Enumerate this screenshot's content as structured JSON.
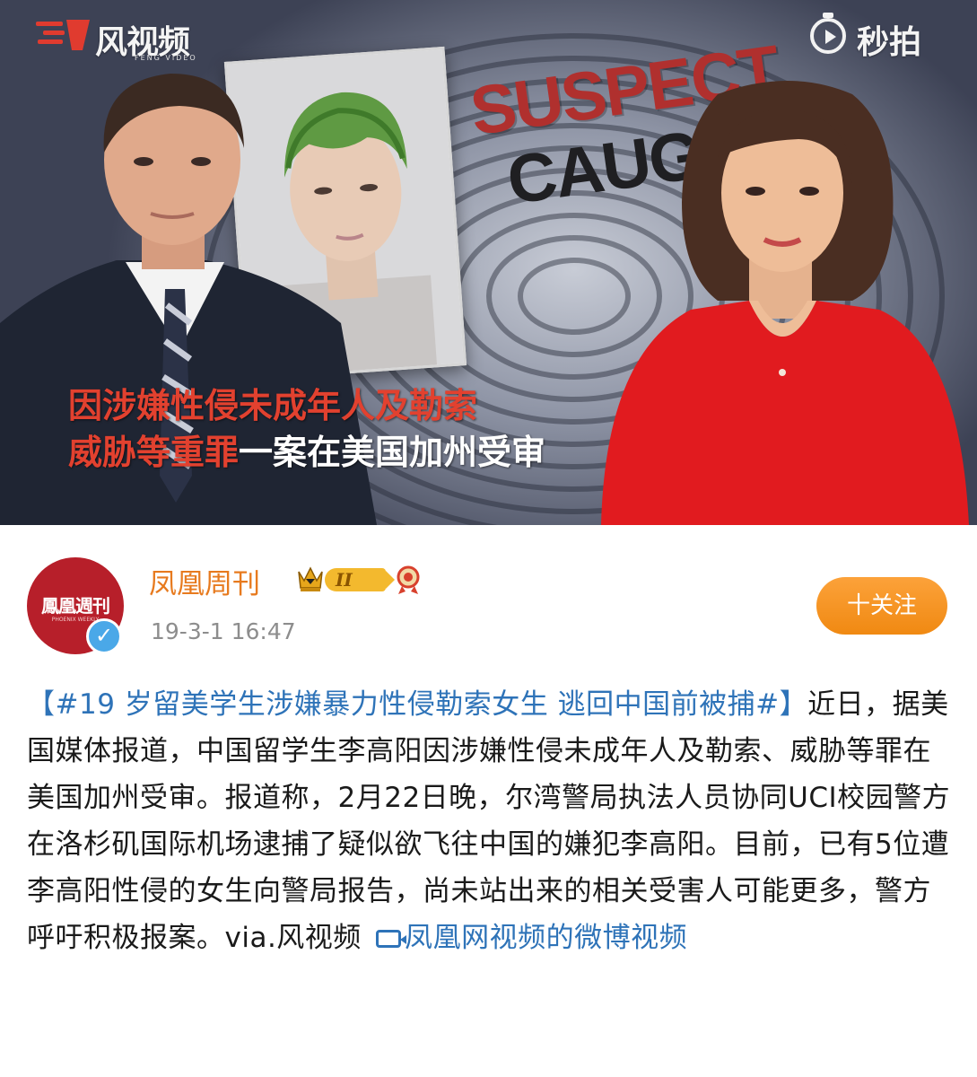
{
  "video": {
    "watermark_left": {
      "text": "风视频",
      "subtext": "FENG VIDEO"
    },
    "watermark_right": {
      "text": "秒拍"
    },
    "headline": {
      "line1": "SUSPECT",
      "line2": "CAUGHT"
    },
    "caption": {
      "line1_red": "因涉嫌性侵未成年人及勒索",
      "line2_red": "威胁等重罪",
      "line2_white": "一案在美国加州受审"
    }
  },
  "post": {
    "avatar_text": "鳳凰週刊",
    "avatar_subtext": "PHOENIX WEEKLY",
    "username": "凤凰周刊",
    "vip_level": "II",
    "timestamp": "19-3-1 16:47",
    "follow_label": "十关注",
    "hashtag": "【#19 岁留美学生涉嫌暴力性侵勒索女生 逃回中国前被捕#】",
    "body": "近日，据美国媒体报道，中国留学生李高阳因涉嫌性侵未成年人及勒索、威胁等罪在美国加州受审。报道称，2月22日晚，尔湾警局执法人员协同UCI校园警方在洛杉矶国际机场逮捕了疑似欲飞往中国的嫌犯李高阳。目前，已有5位遭李高阳性侵的女生向警局报告，尚未站出来的相关受害人可能更多，警方呼吁积极报案。via.风视频 ",
    "link_text": "凤凰网视频的微博视频"
  },
  "colors": {
    "username": "#e77a1e",
    "link": "#2e73b8",
    "follow_button": "#f59521",
    "caption_red": "#e2412f",
    "suspect_red": "#b0302e"
  },
  "icons": [
    "feng-video-logo",
    "miaopai-logo",
    "verified-icon",
    "crown-icon",
    "vip-badge-icon",
    "medal-icon",
    "video-link-icon"
  ]
}
